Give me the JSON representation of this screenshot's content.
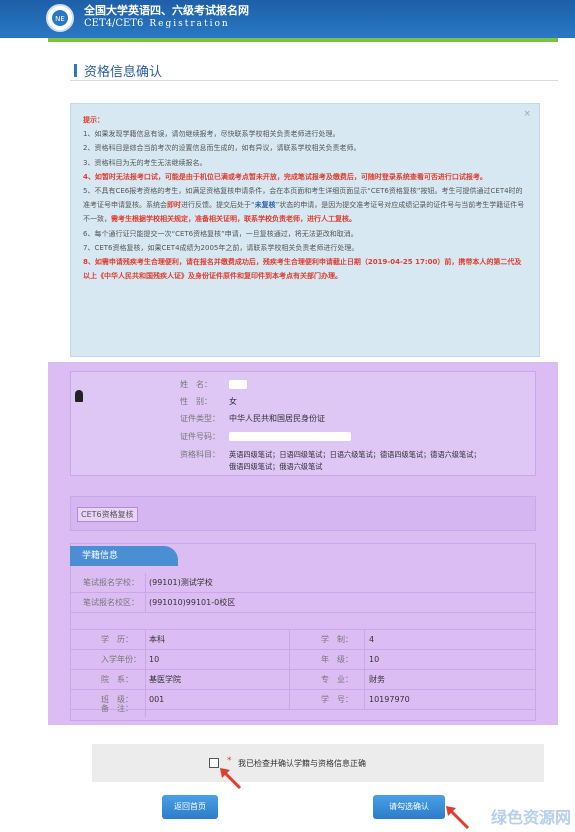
{
  "header": {
    "title_cn": "全国大学英语四、六级考试报名网",
    "title_en": "CET4/CET6",
    "title_reg": "Registration"
  },
  "page_title": "资格信息确认",
  "notice": {
    "heading": "提示：",
    "close": "×",
    "items": [
      "1、如果发现学籍信息有误，请勿继续报考，尽快联系学校相关负责老师进行处理。",
      "2、资格科目是综合当前考次的设置信息而生成的，如有异议，请联系学校相关负责老师。",
      "3、资格科目为无的考生无法继续报名。",
      "4、如暂时无法报考口试，可能是由于机位已满或考点暂未开放，完成笔试报考及缴费后，可随时登录系统查看可否进行口试报考。",
      "5、不具有CE6报考资格的考生，如满足资格复核申请条件，会在本页面和考生详细页面显示“CET6资格复核”按钮。考生可提供通过CET4时的准考证号申请复核。系统会即时进行反馈。提交后处于“未复核”状态的申请，是因为提交准考证号对应成绩记录的证件号与当前考生学籍证件号不一致，需考生根据学校相关规定，准备相关证明，联系学校负责老师，进行人工复核。",
      "6、每个通行证只能提交一次“CET6资格复核”申请，一旦复核通过，将无法更改和取消。",
      "7、CET6资格复核，如果CET4成绩为2005年之前，请联系学校相关负责老师进行处理。",
      "8、如需申请残疾考生合理便利，请在报名并缴费成功后，残疾考生合理便利申请截止日期（2019-04-25 17:00）前，携带本人的第二代及以上《中华人民共和国残疾人证》及身份证件原件和复印件到本考点有关部门办理。"
    ],
    "item4_black": "5、不具有CE6报考资格的考生，如满足资格复核申请条件，会在本页面和考生详细页面显示“CET6资格复核”按钮。",
    "item5_a": "考生可提供通过CET4时的准考证号申请复核。系统会",
    "item5_b": "即时",
    "item5_c": "进行反馈。提交后处于“",
    "item5_d": "未复核",
    "item5_e": "”状态的申请，是因为提交",
    "item5_f": "准考证号对应成绩记录的证件号与当前考生学籍证件号不一致，",
    "item5_g": "需考生根据学校相关规定，准备相关证明，联系学校负责老师，进行人工复核。"
  },
  "profile": {
    "name_label": "姓　名：",
    "gender_label": "性　别：",
    "gender": "女",
    "idtype_label": "证件类型：",
    "idtype": "中华人民共和国居民身份证",
    "idno_label": "证件号码：",
    "subjects_label": "资格科目：",
    "subjects_line1": "英语四级笔试；日语四级笔试；日语六级笔试；德语四级笔试；德语六级笔试；",
    "subjects_line2": "俄语四级笔试；俄语六级笔试"
  },
  "cet6_button": "CET6资格复核",
  "school": {
    "tab": "学籍信息",
    "school_label": "笔试报名学校：",
    "school_value": "(99101)测试学校",
    "campus_label": "笔试报名校区：",
    "campus_value": "(991010)99101-0校区",
    "degree_label": "学　历：",
    "degree_value": "本科",
    "system_label": "学　制：",
    "system_value": "4",
    "year_label": "入学年份：",
    "year_value": "10",
    "grade_label": "年　级：",
    "grade_value": "10",
    "dept_label": "院　系：",
    "dept_value": "基医学院",
    "major_label": "专　业：",
    "major_value": "财务",
    "class_label": "班　级：",
    "class_value": "001",
    "stuno_label": "学　号：",
    "stuno_value": "10197970",
    "remark_label": "备　注："
  },
  "confirm": {
    "star": "*",
    "text": "我已检查并确认学籍与资格信息正确"
  },
  "buttons": {
    "back": "返回首页",
    "next": "请勾选确认"
  },
  "watermark": "绿色资源网"
}
